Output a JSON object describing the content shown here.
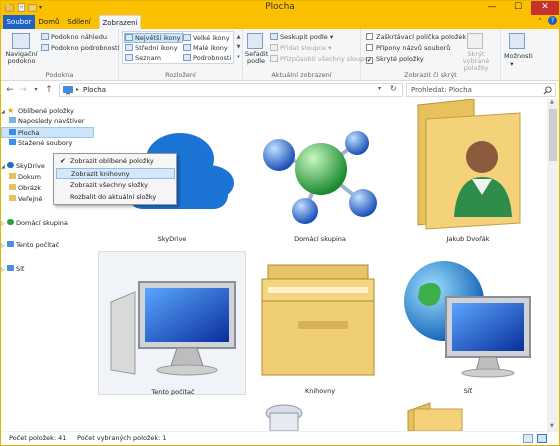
{
  "window": {
    "title": "Plocha",
    "controls": {
      "minimize": "—",
      "maximize": "☐",
      "close": "✕"
    }
  },
  "ribbon_tabs": [
    {
      "label": "Soubor"
    },
    {
      "label": "Domů"
    },
    {
      "label": "Sdílení"
    },
    {
      "label": "Zobrazení"
    }
  ],
  "ribbon": {
    "panes": {
      "nav_pane": "Navigační podokno",
      "preview_pane": "Podokno náhledu",
      "details_pane": "Podokno podrobností",
      "group_label": "Podokna"
    },
    "layout": {
      "items": [
        "Největší ikony",
        "Velké ikony",
        "Střední ikony",
        "Malé ikony",
        "Seznam",
        "Podrobnosti"
      ],
      "group_label": "Rozložení"
    },
    "current_view": {
      "sort_by": "Seřadit podle",
      "group_by": "Seskupit podle",
      "add_columns": "Přidat sloupce",
      "fit_columns": "Přizpůsobit všechny sloupce",
      "group_label": "Aktuální zobrazení"
    },
    "show_hide": {
      "item_checkboxes": "Zaškrtávací políčka položek",
      "file_extensions": "Přípony názvů souborů",
      "hidden_items": "Skryté položky",
      "hide_selected": "Skrýt vybrané položky",
      "group_label": "Zobrazit či skrýt"
    },
    "options": "Možnosti"
  },
  "address": {
    "path": "Plocha",
    "search_placeholder": "Prohledat: Plocha"
  },
  "nav_pane": {
    "favorites_header": "Oblíbené položky",
    "favorites": [
      "Naposledy navštíver",
      "Plocha",
      "Stažené soubory"
    ],
    "skydrive": "SkyDrive",
    "skydrive_children": [
      "Dokum",
      "Obrázk",
      "Veřejné"
    ],
    "homegroup": "Domácí skupina",
    "computer": "Tento počítač",
    "network": "Síť"
  },
  "context_menu": {
    "items": [
      {
        "label": "Zobrazit oblíbené položky",
        "checked": true
      },
      {
        "label": "Zobrazit knihovny",
        "checked": false
      },
      {
        "label": "Zobrazit všechny složky",
        "checked": false
      },
      {
        "label": "Rozbalit do aktuální složky",
        "checked": false
      }
    ],
    "check_glyph": "✔"
  },
  "items": [
    {
      "name": "SkyDrive",
      "icon": "skydrive-cloud-icon"
    },
    {
      "name": "Domácí skupina",
      "icon": "homegroup-icon"
    },
    {
      "name": "Jakub Dvořák",
      "icon": "user-folder-icon"
    },
    {
      "name": "Tento počítač",
      "icon": "computer-icon"
    },
    {
      "name": "Knihovny",
      "icon": "libraries-icon"
    },
    {
      "name": "Síť",
      "icon": "network-icon"
    }
  ],
  "status": {
    "count": "Počet položek: 41",
    "selected": "Počet vybraných položek: 1"
  },
  "colors": {
    "accent": "#fbc100",
    "file_tab": "#1e62c5",
    "selection": "#cce4f7"
  }
}
